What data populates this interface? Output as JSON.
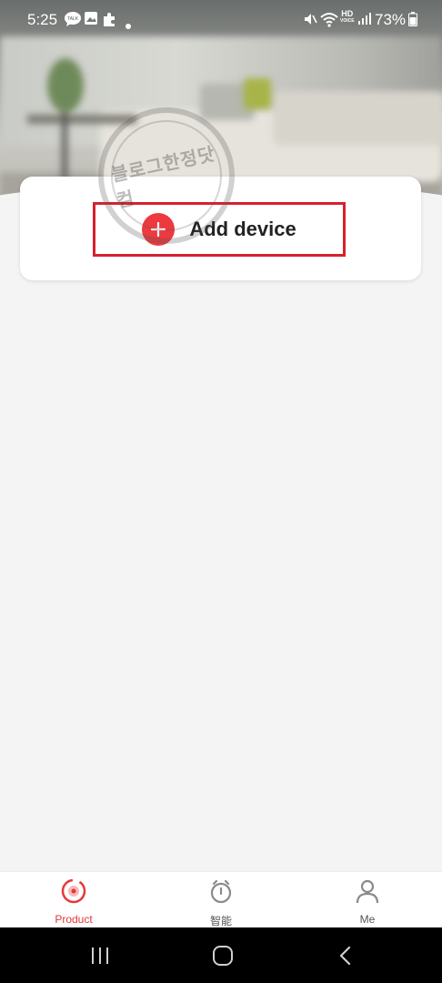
{
  "status_bar": {
    "time": "5:25",
    "talk_badge": "TALK",
    "battery": "73%",
    "hd_label": "HD",
    "voice_label": "VOICE"
  },
  "main": {
    "add_device_label": "Add device"
  },
  "watermark": {
    "text": "블로그한정닷컴"
  },
  "bottom_nav": {
    "items": [
      {
        "label": "Product",
        "icon": "product-icon",
        "active": true
      },
      {
        "label": "智能",
        "icon": "smart-timer-icon",
        "active": false
      },
      {
        "label": "Me",
        "icon": "person-icon",
        "active": false
      }
    ]
  },
  "colors": {
    "accent": "#e5383b",
    "highlight_border": "#d8202e",
    "inactive": "#777777"
  }
}
